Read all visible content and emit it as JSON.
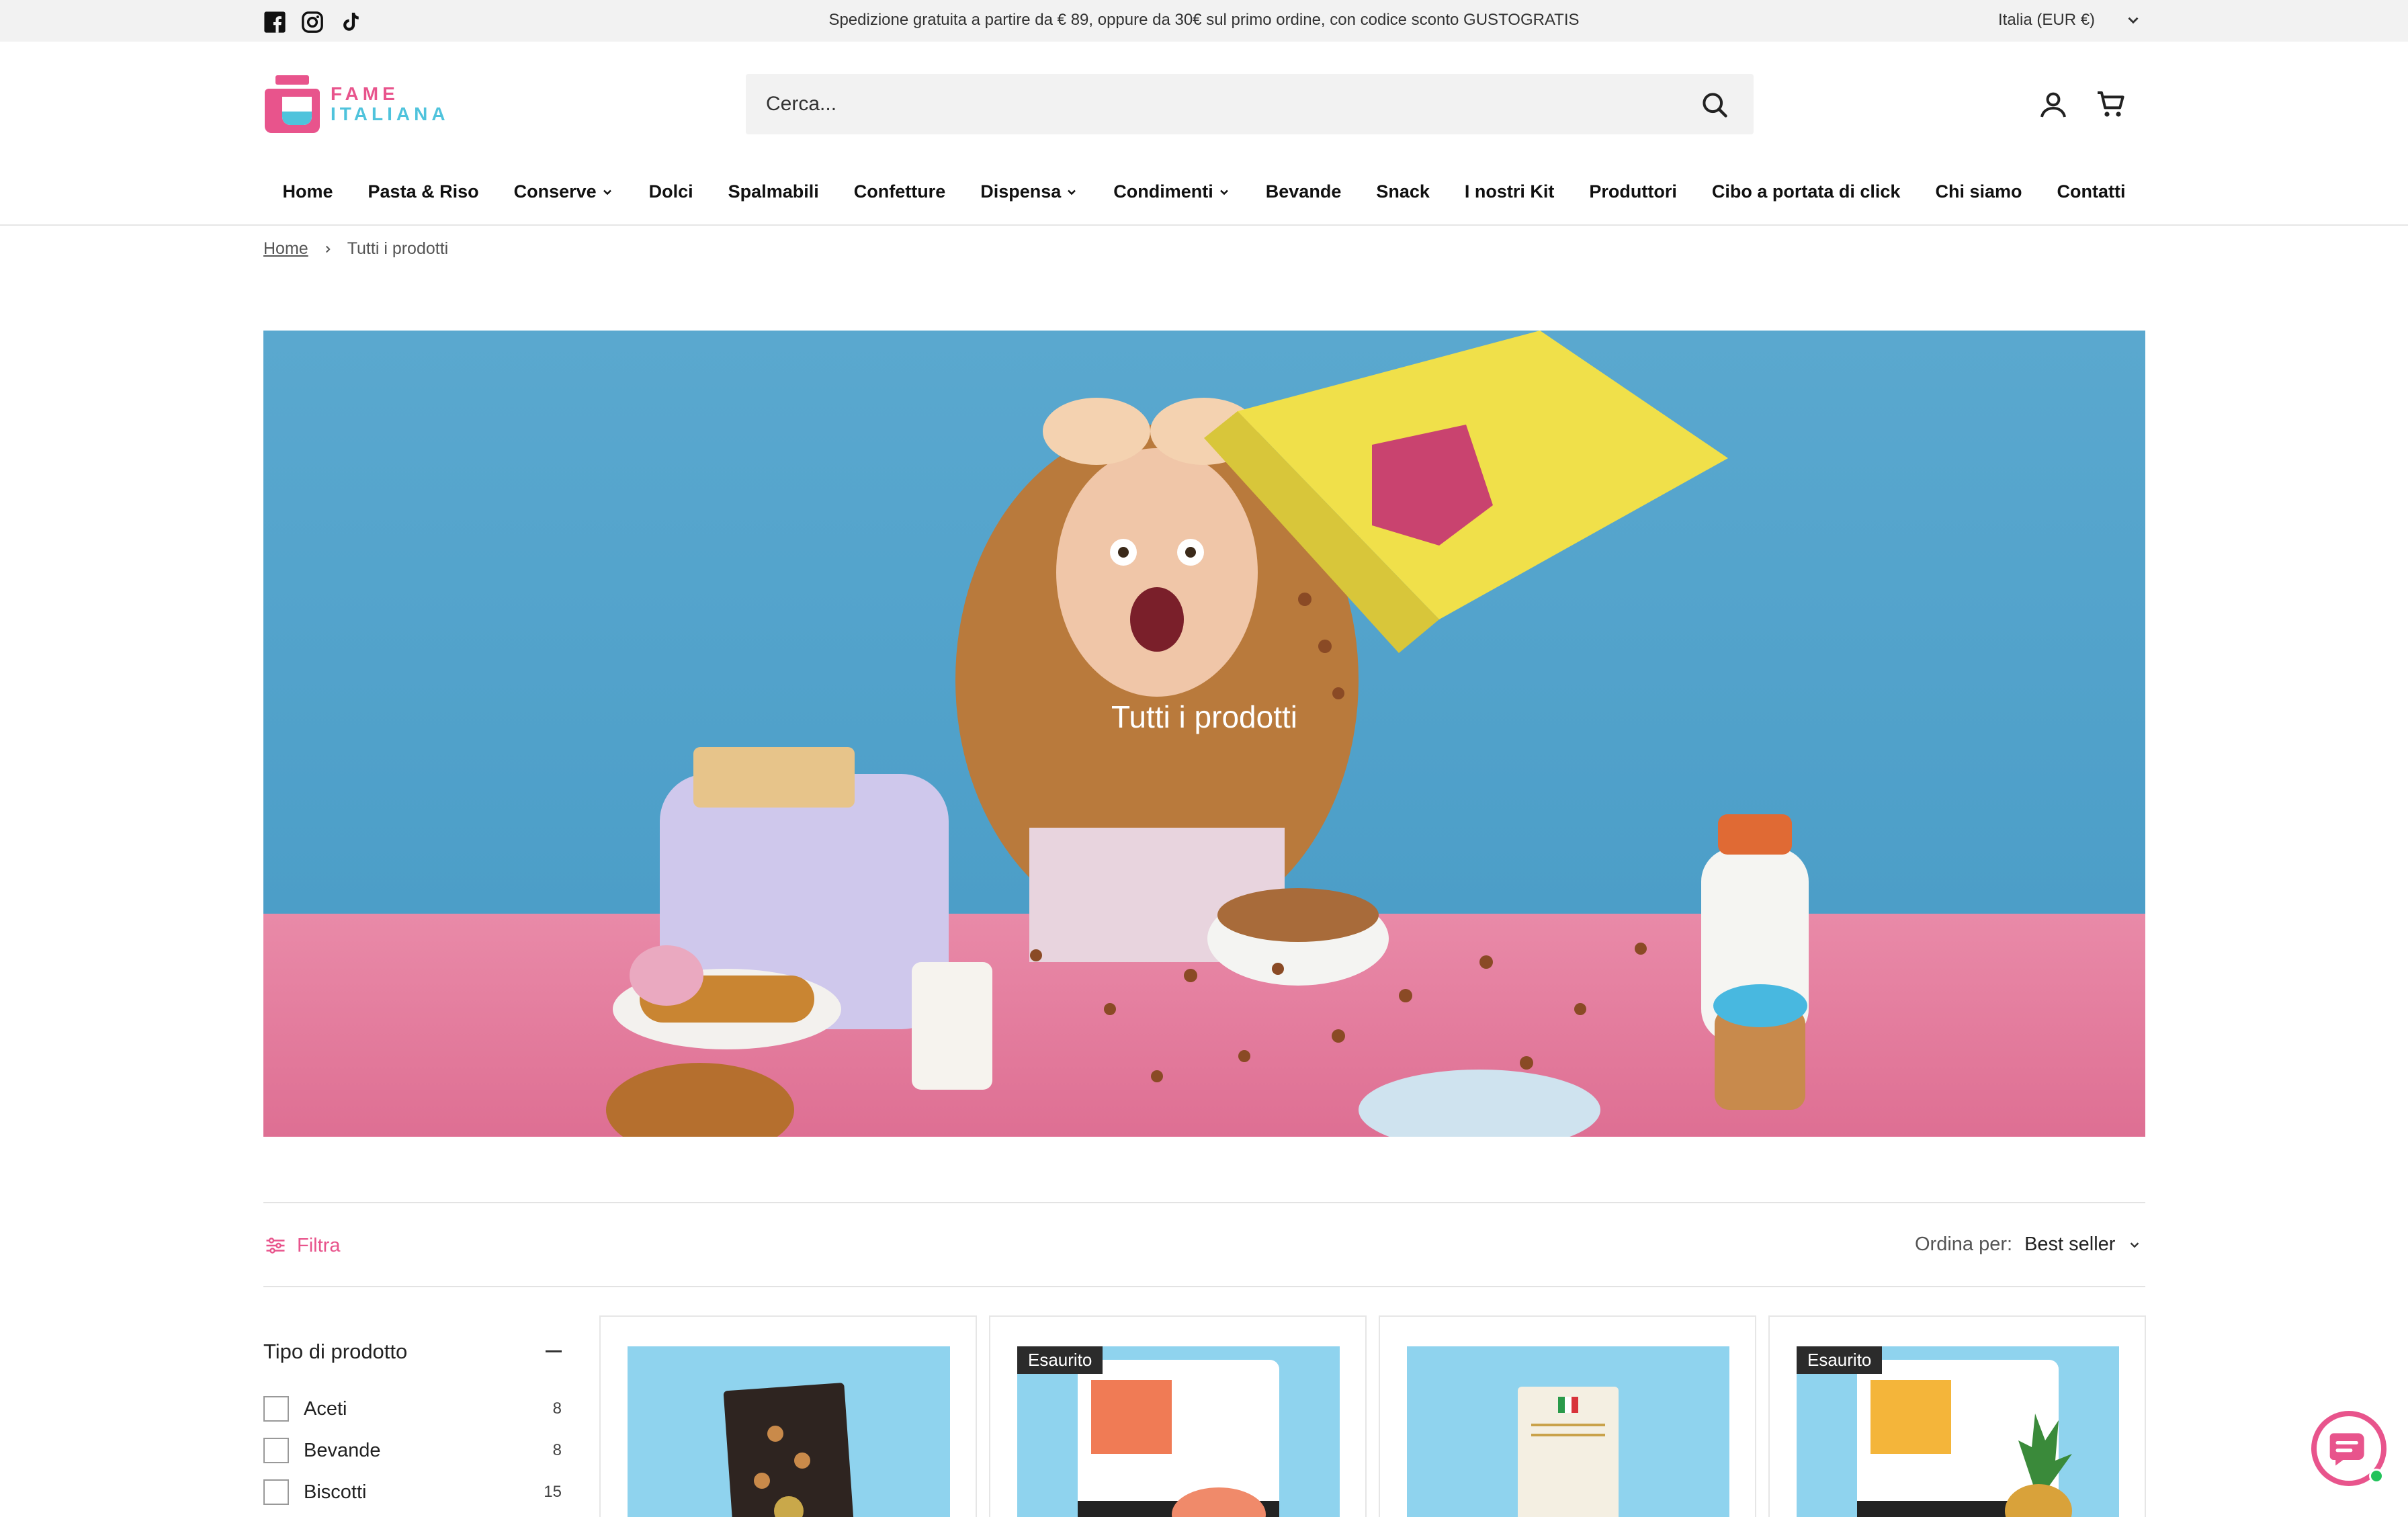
{
  "announcement": {
    "text": "Spedizione gratuita a partire da € 89, oppure da 30€ sul primo ordine, con codice sconto GUSTOGRATIS",
    "locale": "Italia (EUR €)"
  },
  "brand": {
    "line1": "FAME",
    "line2": "ITALIANA",
    "pink": "#e8548c",
    "cyan": "#4fc3dc"
  },
  "search": {
    "placeholder": "Cerca..."
  },
  "nav": {
    "items": [
      {
        "label": "Home"
      },
      {
        "label": "Pasta & Riso"
      },
      {
        "label": "Conserve"
      },
      {
        "label": "Dolci"
      },
      {
        "label": "Spalmabili"
      },
      {
        "label": "Confetture"
      },
      {
        "label": "Dispensa"
      },
      {
        "label": "Condimenti"
      },
      {
        "label": "Bevande"
      },
      {
        "label": "Snack"
      },
      {
        "label": "I nostri Kit"
      },
      {
        "label": "Produttori"
      },
      {
        "label": "Cibo a portata di click"
      },
      {
        "label": "Chi siamo"
      },
      {
        "label": "Contatti"
      }
    ]
  },
  "breadcrumb": {
    "home": "Home",
    "current": "Tutti i prodotti"
  },
  "hero": {
    "title": "Tutti i prodotti"
  },
  "toolbar": {
    "filter_label": "Filtra",
    "sort_label": "Ordina per:",
    "sort_value": "Best seller"
  },
  "sidebar": {
    "heading": "Tipo di prodotto",
    "options": [
      {
        "label": "Aceti",
        "count": "8"
      },
      {
        "label": "Bevande",
        "count": "8"
      },
      {
        "label": "Biscotti",
        "count": "15"
      }
    ]
  },
  "products": [
    {
      "badge": ""
    },
    {
      "badge": "Esaurito"
    },
    {
      "badge": ""
    },
    {
      "badge": "Esaurito"
    }
  ]
}
